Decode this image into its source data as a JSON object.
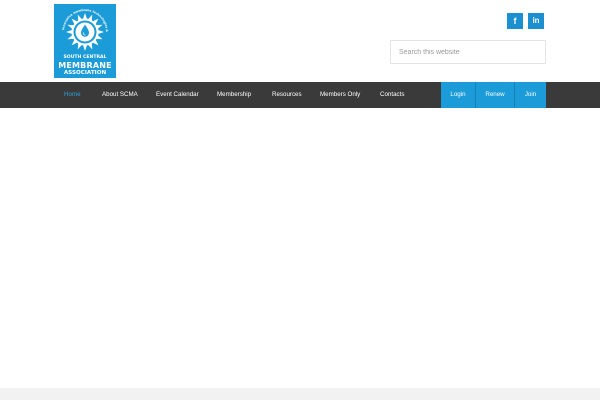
{
  "logo": {
    "arc_text": "innovative membrane technologies & water solutions",
    "line1": "SOUTH CENTRAL",
    "line2": "MEMBRANE",
    "line3": "ASSOCIATION"
  },
  "social": {
    "facebook_icon": "facebook-icon",
    "facebook_glyph": "f",
    "linkedin_icon": "linkedin-icon",
    "linkedin_glyph": "in"
  },
  "search": {
    "placeholder": "Search this website",
    "value": ""
  },
  "nav": {
    "items": [
      {
        "label": "Home",
        "active": true
      },
      {
        "label": "About SCMA"
      },
      {
        "label": "Event Calendar"
      },
      {
        "label": "Membership"
      },
      {
        "label": "Resources"
      },
      {
        "label": "Members Only"
      },
      {
        "label": "Contacts"
      }
    ],
    "buttons": [
      {
        "label": "Login"
      },
      {
        "label": "Renew"
      },
      {
        "label": "Join"
      }
    ]
  },
  "colors": {
    "brand_blue": "#1b9bd7",
    "nav_bg": "#3a3a3a",
    "active_link": "#2aa3dd"
  }
}
